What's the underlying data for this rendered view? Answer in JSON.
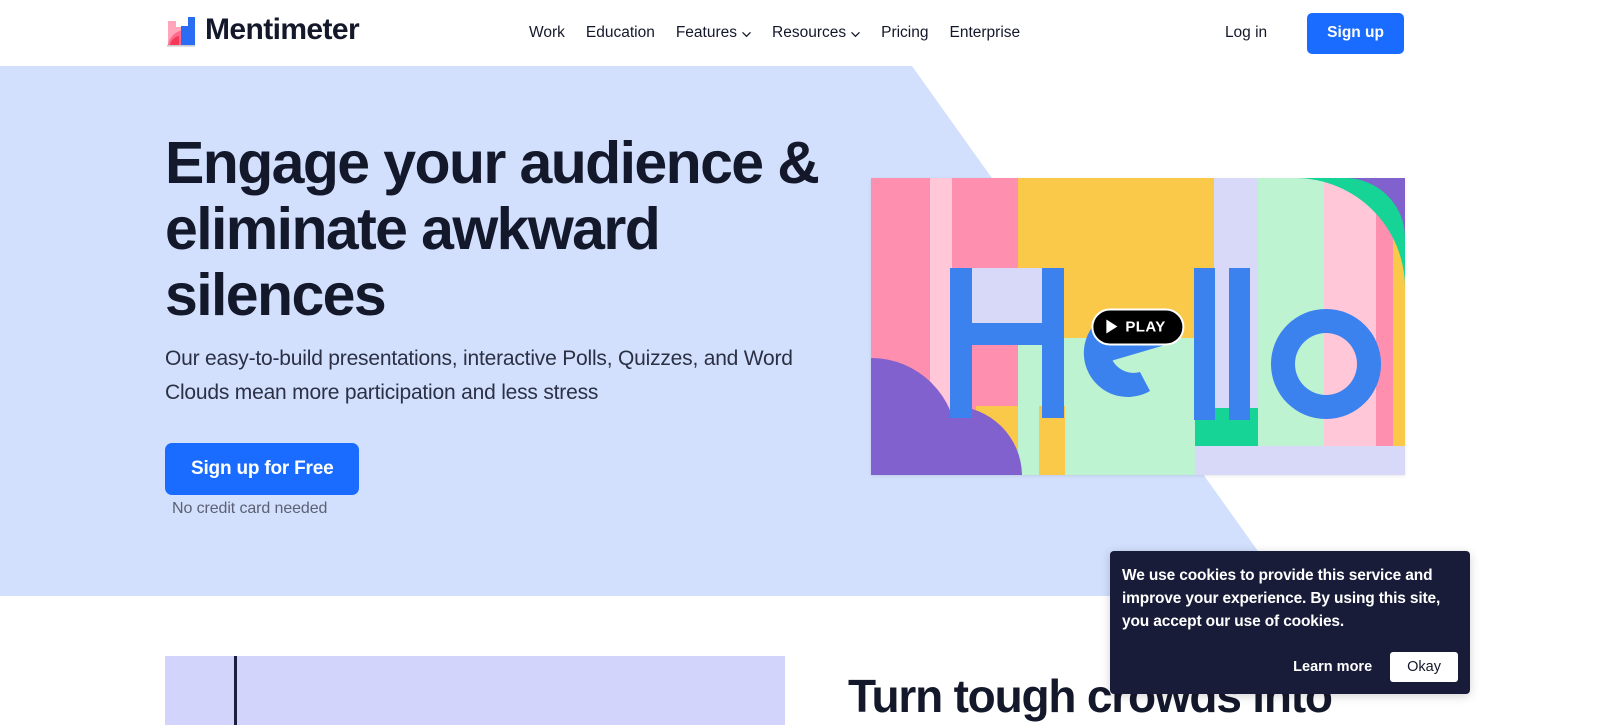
{
  "brand": {
    "name": "Mentimeter",
    "logo_icon": "bar-chart-logo-icon",
    "colors": {
      "pink": "#ff6b8a",
      "light_pink": "#ffa6bb",
      "blue": "#2a6df4"
    }
  },
  "header": {
    "nav": [
      {
        "label": "Work",
        "has_dropdown": false
      },
      {
        "label": "Education",
        "has_dropdown": false
      },
      {
        "label": "Features",
        "has_dropdown": true
      },
      {
        "label": "Resources",
        "has_dropdown": true
      },
      {
        "label": "Pricing",
        "has_dropdown": false
      },
      {
        "label": "Enterprise",
        "has_dropdown": false
      }
    ],
    "login_label": "Log in",
    "signup_label": "Sign up"
  },
  "hero": {
    "title": "Engage your audience & eliminate awkward silences",
    "subtitle": "Our easy-to-build presentations, interactive Polls, Quizzes, and Word Clouds mean more participation and less stress",
    "cta_label": "Sign up for Free",
    "note": "No credit card needed",
    "background_color": "#d2e0fd"
  },
  "video": {
    "word": "Hello",
    "play_label": "PLAY",
    "play_icon": "play-triangle-icon",
    "palette": {
      "pink": "#ff8fae",
      "light_pink": "#ffc7d7",
      "yellow": "#fbc94a",
      "lavender": "#d8d8f8",
      "mint": "#bdf3d0",
      "green": "#16d396",
      "purple": "#8061cd",
      "blue": "#3b82ef"
    }
  },
  "lower": {
    "heading": "Turn tough crowds into"
  },
  "cookie": {
    "message": "We use cookies to provide this service and improve your experience. By using this site, you accept our use of cookies.",
    "learn_more_label": "Learn more",
    "okay_label": "Okay",
    "background_color": "#181c38"
  },
  "colors": {
    "accent_blue": "#196cff",
    "text_dark": "#14182b",
    "hero_bg": "#d2e0fd",
    "lower_bg": "#d3d4fb"
  }
}
